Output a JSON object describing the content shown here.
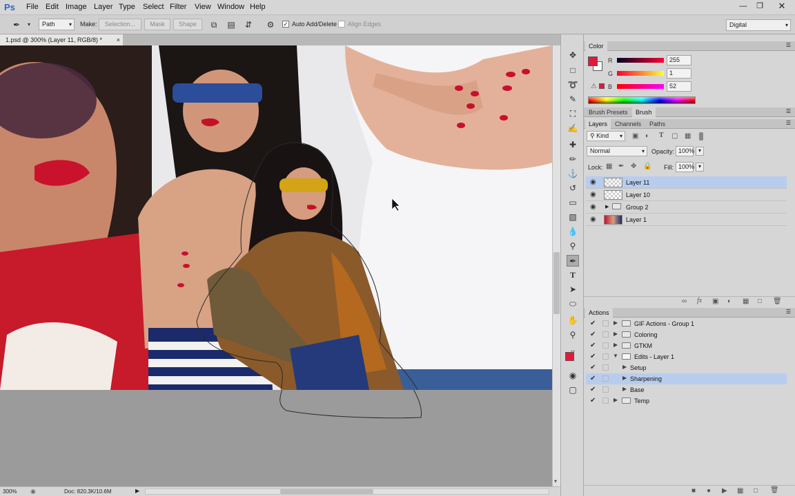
{
  "app": {
    "logo": "Ps"
  },
  "menu": [
    "File",
    "Edit",
    "Image",
    "Layer",
    "Type",
    "Select",
    "Filter",
    "View",
    "Window",
    "Help"
  ],
  "options": {
    "mode_value": "Path",
    "make_label": "Make:",
    "selection_btn": "Selection...",
    "mask_btn": "Mask",
    "shape_btn": "Shape",
    "auto_add_delete": "Auto Add/Delete",
    "auto_add_checked": true,
    "align_edges": "Align Edges",
    "align_edges_checked": false,
    "workspace": "Digital"
  },
  "document": {
    "tab_title": "1.psd @ 300% (Layer 11, RGB/8) *",
    "close": "×"
  },
  "status": {
    "zoom": "300%",
    "doc_info": "Doc: 820.3K/10.6M"
  },
  "color_panel": {
    "title": "Color",
    "fg_color": "#e3193a",
    "r_label": "R",
    "r_value": "255",
    "g_label": "G",
    "g_value": "1",
    "b_label": "B",
    "b_value": "52"
  },
  "brush_tabs": [
    "Brush Presets",
    "Brush"
  ],
  "layers_panel": {
    "tabs": [
      "Layers",
      "Channels",
      "Paths"
    ],
    "kind": "Kind",
    "blend_mode": "Normal",
    "opacity_label": "Opacity:",
    "opacity_value": "100%",
    "lock_label": "Lock:",
    "fill_label": "Fill:",
    "fill_value": "100%",
    "layers": [
      {
        "name": "Layer 11",
        "selected": true
      },
      {
        "name": "Layer 10",
        "selected": false
      },
      {
        "name": "Group 2",
        "selected": false
      },
      {
        "name": "Layer 1",
        "selected": false
      }
    ]
  },
  "actions_panel": {
    "title": "Actions",
    "items": [
      {
        "label": "GIF Actions - Group 1"
      },
      {
        "label": "Coloring"
      },
      {
        "label": "GTKM"
      },
      {
        "label": "Edits - Layer 1"
      },
      {
        "label": "Setup"
      },
      {
        "label": "Sharpening"
      },
      {
        "label": "Base"
      },
      {
        "label": "Temp"
      }
    ]
  }
}
